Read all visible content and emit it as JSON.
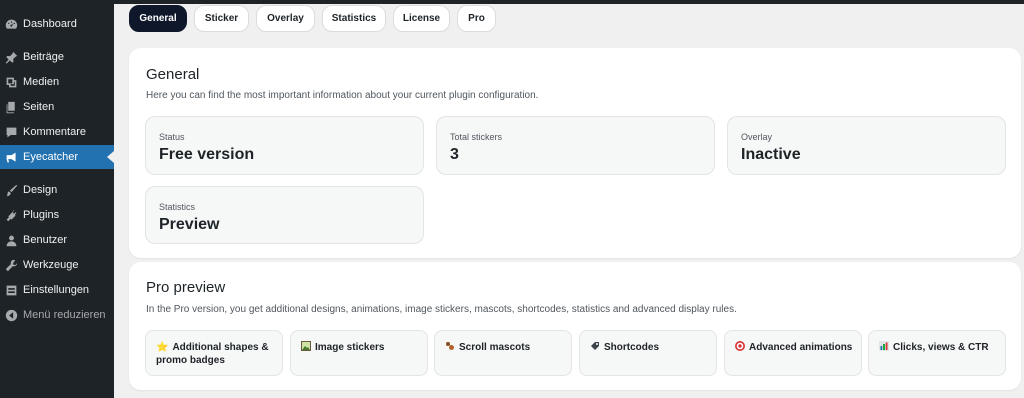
{
  "sidebar": {
    "items": [
      {
        "label": "Dashboard",
        "icon": "dashboard-icon"
      },
      {
        "label": "Beiträge",
        "icon": "pin-icon"
      },
      {
        "label": "Medien",
        "icon": "media-icon"
      },
      {
        "label": "Seiten",
        "icon": "pages-icon"
      },
      {
        "label": "Kommentare",
        "icon": "comment-icon"
      },
      {
        "label": "Eyecatcher",
        "icon": "megaphone-icon",
        "active": true
      },
      {
        "label": "Design",
        "icon": "brush-icon"
      },
      {
        "label": "Plugins",
        "icon": "plug-icon"
      },
      {
        "label": "Benutzer",
        "icon": "user-icon"
      },
      {
        "label": "Werkzeuge",
        "icon": "wrench-icon"
      },
      {
        "label": "Einstellungen",
        "icon": "settings-icon"
      },
      {
        "label": "Menü reduzieren",
        "icon": "collapse-icon"
      }
    ]
  },
  "tabs": [
    "General",
    "Sticker",
    "Overlay",
    "Statistics",
    "License",
    "Pro"
  ],
  "general": {
    "title": "General",
    "description": "Here you can find the most important information about your current plugin configuration.",
    "stats": [
      {
        "label": "Status",
        "value": "Free version"
      },
      {
        "label": "Total stickers",
        "value": "3"
      },
      {
        "label": "Overlay",
        "value": "Inactive"
      },
      {
        "label": "Statistics",
        "value": "Preview"
      }
    ]
  },
  "pro": {
    "title": "Pro preview",
    "description": "In the Pro version, you get additional designs, animations, image stickers, mascots, shortcodes, statistics and advanced display rules.",
    "features": [
      {
        "icon": "star-icon",
        "label": "Additional shapes & promo badges"
      },
      {
        "icon": "image-icon",
        "label": "Image stickers"
      },
      {
        "icon": "paw-icon",
        "label": "Scroll mascots"
      },
      {
        "icon": "tag-icon",
        "label": "Shortcodes"
      },
      {
        "icon": "target-icon",
        "label": "Advanced animations"
      },
      {
        "icon": "chart-icon",
        "label": "Clicks, views & CTR"
      }
    ]
  },
  "colors": {
    "accent": "#2271b1",
    "sidebar": "#1d2327",
    "tab_active": "#0f172a"
  }
}
